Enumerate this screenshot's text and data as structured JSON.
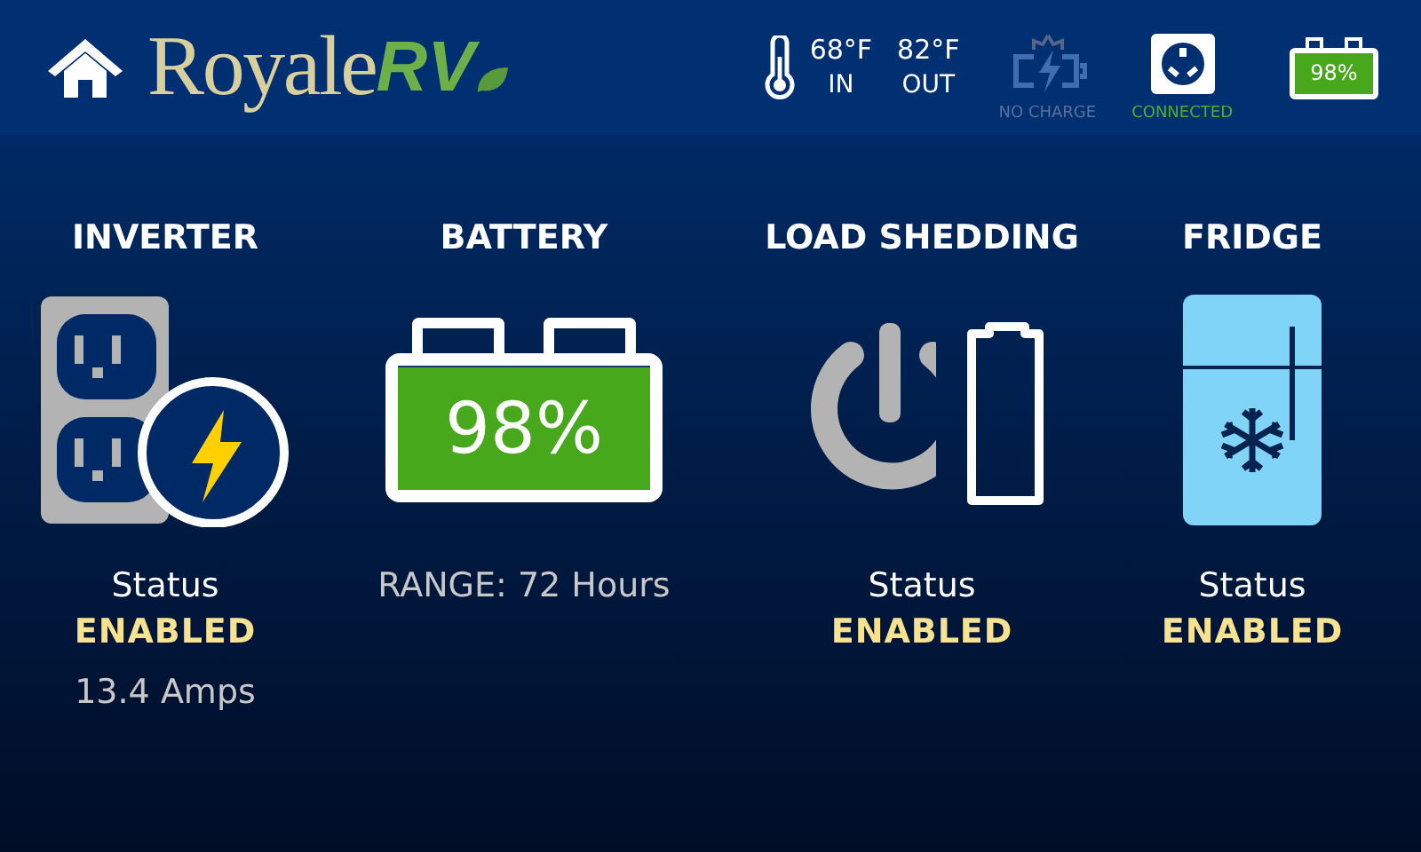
{
  "header": {
    "logo": {
      "name": "Royale",
      "suffix": "RV"
    },
    "temperatures": [
      {
        "value": "68°F",
        "label": "IN"
      },
      {
        "value": "82°F",
        "label": "OUT"
      }
    ],
    "indicators": [
      {
        "kind": "solar",
        "label": "NO CHARGE"
      },
      {
        "kind": "shore",
        "label": "CONNECTED"
      }
    ],
    "battery": {
      "reading": "98%"
    }
  },
  "panels": [
    {
      "kind": "inverter",
      "title": "INVERTER",
      "status_label": "Status",
      "status": "ENABLED",
      "detail": "13.4 Amps"
    },
    {
      "kind": "battery",
      "title": "BATTERY",
      "level": 0.98,
      "reading": "98%",
      "detail": "RANGE: 72 Hours"
    },
    {
      "kind": "load",
      "title": "LOAD SHEDDING",
      "status_label": "Status",
      "status": "ENABLED"
    },
    {
      "kind": "fridge",
      "title": "FRIDGE",
      "status_label": "Status",
      "status": "ENABLED"
    }
  ]
}
